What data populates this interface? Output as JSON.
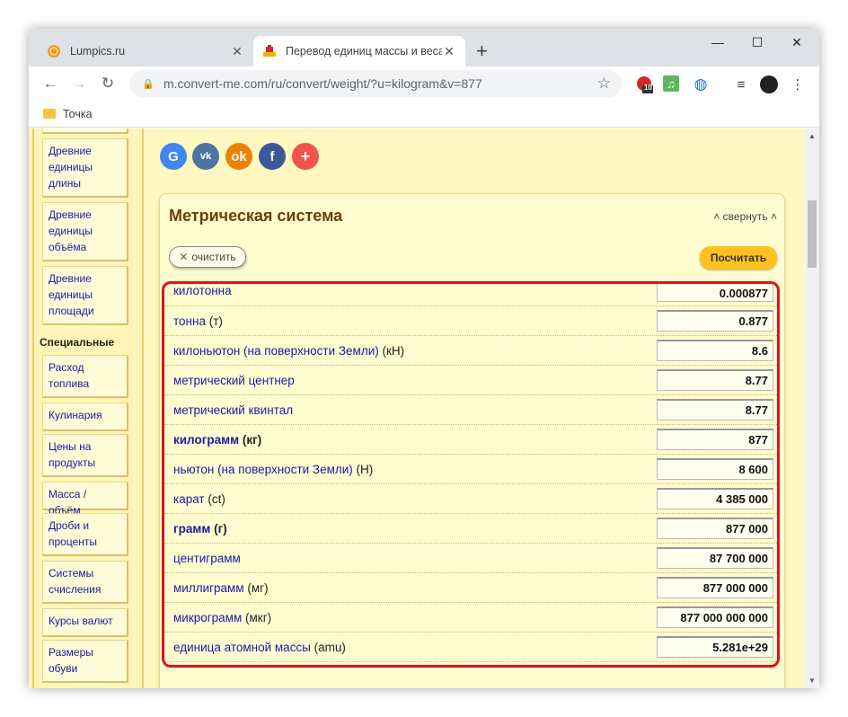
{
  "browser": {
    "tabs": [
      {
        "title": "Lumpics.ru",
        "active": false
      },
      {
        "title": "Перевод единиц массы и веса",
        "active": true
      }
    ],
    "new_tab": "+",
    "url": "m.convert-me.com/ru/convert/weight/?u=kilogram&v=877",
    "bookmarks": [
      {
        "label": "Точка"
      }
    ],
    "extension_badge": "10",
    "window_controls": {
      "minimize": "—",
      "maximize": "☐",
      "close": "✕"
    }
  },
  "sidebar": {
    "items_top": [
      {
        "label": "Древние единицы длины"
      },
      {
        "label": "Древние единицы объёма"
      },
      {
        "label": "Древние единицы площади"
      }
    ],
    "section_heading": "Специальные",
    "items_special": [
      {
        "label": "Расход топлива"
      },
      {
        "label": "Кулинария"
      },
      {
        "label": "Цены на продукты"
      },
      {
        "label": "Масса / объём"
      },
      {
        "label": "Дроби и проценты"
      },
      {
        "label": "Системы счисления"
      },
      {
        "label": "Курсы валют"
      },
      {
        "label": "Размеры обуви"
      }
    ]
  },
  "social": [
    {
      "icon": "google-icon",
      "glyph": "G",
      "color": "#4285f4"
    },
    {
      "icon": "vk-icon",
      "glyph": "vk",
      "color": "#4c75a3"
    },
    {
      "icon": "odnoklassniki-icon",
      "glyph": "ok",
      "color": "#ee8208"
    },
    {
      "icon": "facebook-icon",
      "glyph": "f",
      "color": "#3b5998"
    },
    {
      "icon": "plus-icon",
      "glyph": "+",
      "color": "#f0554a"
    }
  ],
  "panel": {
    "title": "Метрическая система",
    "collapse_label": "свернуть",
    "clear_label": "очистить",
    "calculate_label": "Посчитать",
    "units": [
      {
        "name": "килотонна",
        "symbol": "",
        "value": "0.000877",
        "bold": false
      },
      {
        "name": "тонна",
        "symbol": "(т)",
        "value": "0.877",
        "bold": false
      },
      {
        "name": "килоньютон (на поверхности Земли)",
        "symbol": "(кН)",
        "value": "8.6",
        "bold": false
      },
      {
        "name": "метрический центнер",
        "symbol": "",
        "value": "8.77",
        "bold": false
      },
      {
        "name": "метрический квинтал",
        "symbol": "",
        "value": "8.77",
        "bold": false
      },
      {
        "name": "килограмм",
        "symbol": "(кг)",
        "value": "877",
        "bold": true
      },
      {
        "name": "ньютон (на поверхности Земли)",
        "symbol": "(Н)",
        "value": "8 600",
        "bold": false
      },
      {
        "name": "карат",
        "symbol": "(ct)",
        "value": "4 385 000",
        "bold": false
      },
      {
        "name": "грамм",
        "symbol": "(г)",
        "value": "877 000",
        "bold": true
      },
      {
        "name": "центиграмм",
        "symbol": "",
        "value": "87 700 000",
        "bold": false
      },
      {
        "name": "миллиграмм",
        "symbol": "(мг)",
        "value": "877 000 000",
        "bold": false
      },
      {
        "name": "микрограмм",
        "symbol": "(мкг)",
        "value": "877 000 000 000",
        "bold": false
      },
      {
        "name": "единица атомной массы",
        "symbol": "(amu)",
        "value": "5.281e+29",
        "bold": false
      }
    ]
  },
  "colors": {
    "highlight": "#e3101a",
    "page_bg": "#fff8c0",
    "link": "#1a1aa6",
    "accent_button": "#ffc21e"
  }
}
